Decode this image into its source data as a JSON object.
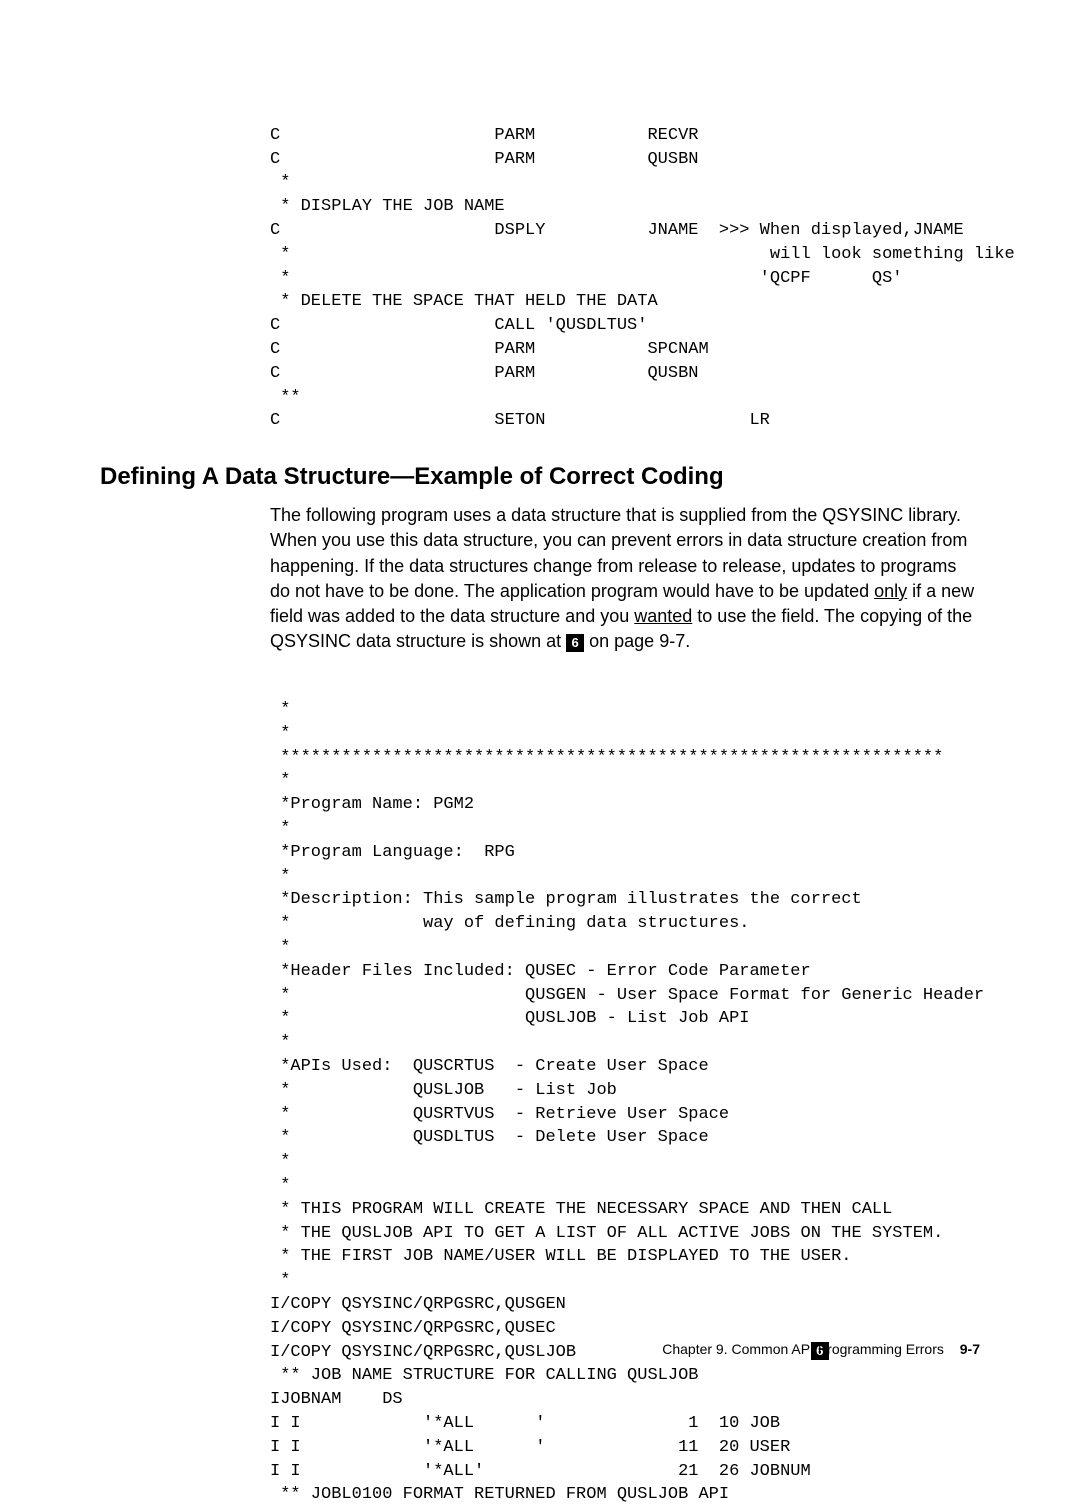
{
  "code1": {
    "l1": "C                     PARM           RECVR",
    "l2": "C                     PARM           QUSBN",
    "l3": " *",
    "l4": " * DISPLAY THE JOB NAME",
    "l5": "C                     DSPLY          JNAME  >>> When displayed,JNAME",
    "l6": " *                                               will look something like",
    "l7": " *                                              'QCPF      QS'",
    "l8": " * DELETE THE SPACE THAT HELD THE DATA",
    "l9": "C                     CALL 'QUSDLTUS'",
    "l10": "C                     PARM           SPCNAM",
    "l11": "C                     PARM           QUSBN",
    "l12": " **",
    "l13": "C                     SETON                    LR"
  },
  "heading": "Defining A Data Structure—Example of Correct Coding",
  "para": {
    "p1": "The following program uses a data structure that is supplied from the QSYSINC library.  When you use this data structure, you can prevent errors in data structure creation from happening.  If the data structures change from release to release, updates to programs do not have to be done.  The application program would have to be updated ",
    "only": "only",
    "p2_after_only": " if a new field was added to the data structure and you ",
    "wanted": "wanted",
    "p3_after_wanted": " to use the field.  The copying of the QSYSINC data structure is shown at ",
    "callout6": "6",
    "p4_after_callout": "  on page 9-7."
  },
  "code2": {
    "l1": " *",
    "l2": " *",
    "l3": " *****************************************************************",
    "l4": " *",
    "l5": " *Program Name: PGM2",
    "l6": " *",
    "l7": " *Program Language:  RPG",
    "l8": " *",
    "l9": " *Description: This sample program illustrates the correct",
    "l10": " *             way of defining data structures.",
    "l11": " *",
    "l12": " *Header Files Included: QUSEC - Error Code Parameter",
    "l13": " *                       QUSGEN - User Space Format for Generic Header",
    "l14": " *                       QUSLJOB - List Job API",
    "l15": " *",
    "l16": " *APIs Used:  QUSCRTUS  - Create User Space",
    "l17": " *            QUSLJOB   - List Job",
    "l18": " *            QUSRTVUS  - Retrieve User Space",
    "l19": " *            QUSDLTUS  - Delete User Space",
    "l20": " *",
    "l21": " *",
    "l22": " * THIS PROGRAM WILL CREATE THE NECESSARY SPACE AND THEN CALL",
    "l23": " * THE QUSLJOB API TO GET A LIST OF ALL ACTIVE JOBS ON THE SYSTEM.",
    "l24": " * THE FIRST JOB NAME/USER WILL BE DISPLAYED TO THE USER.",
    "l25": " *",
    "l26": "I/COPY QSYSINC/QRPGSRC,QUSGEN",
    "l27": "I/COPY QSYSINC/QRPGSRC,QUSEC",
    "l28a": "I/COPY QSYSINC/QRPGSRC,QUSLJOB                       ",
    "l28callout": "6",
    "l29": " ** JOB NAME STRUCTURE FOR CALLING QUSLJOB",
    "l30": "IJOBNAM    DS",
    "l31": "I I            '*ALL      '              1  10 JOB",
    "l32": "I I            '*ALL      '             11  20 USER",
    "l33": "I I            '*ALL'                   21  26 JOBNUM",
    "l34": " ** JOBL0100 FORMAT RETURNED FROM QUSLJOB API"
  },
  "footer": {
    "chapter": "Chapter 9.  Common API Programming Errors",
    "page": "9-7"
  }
}
